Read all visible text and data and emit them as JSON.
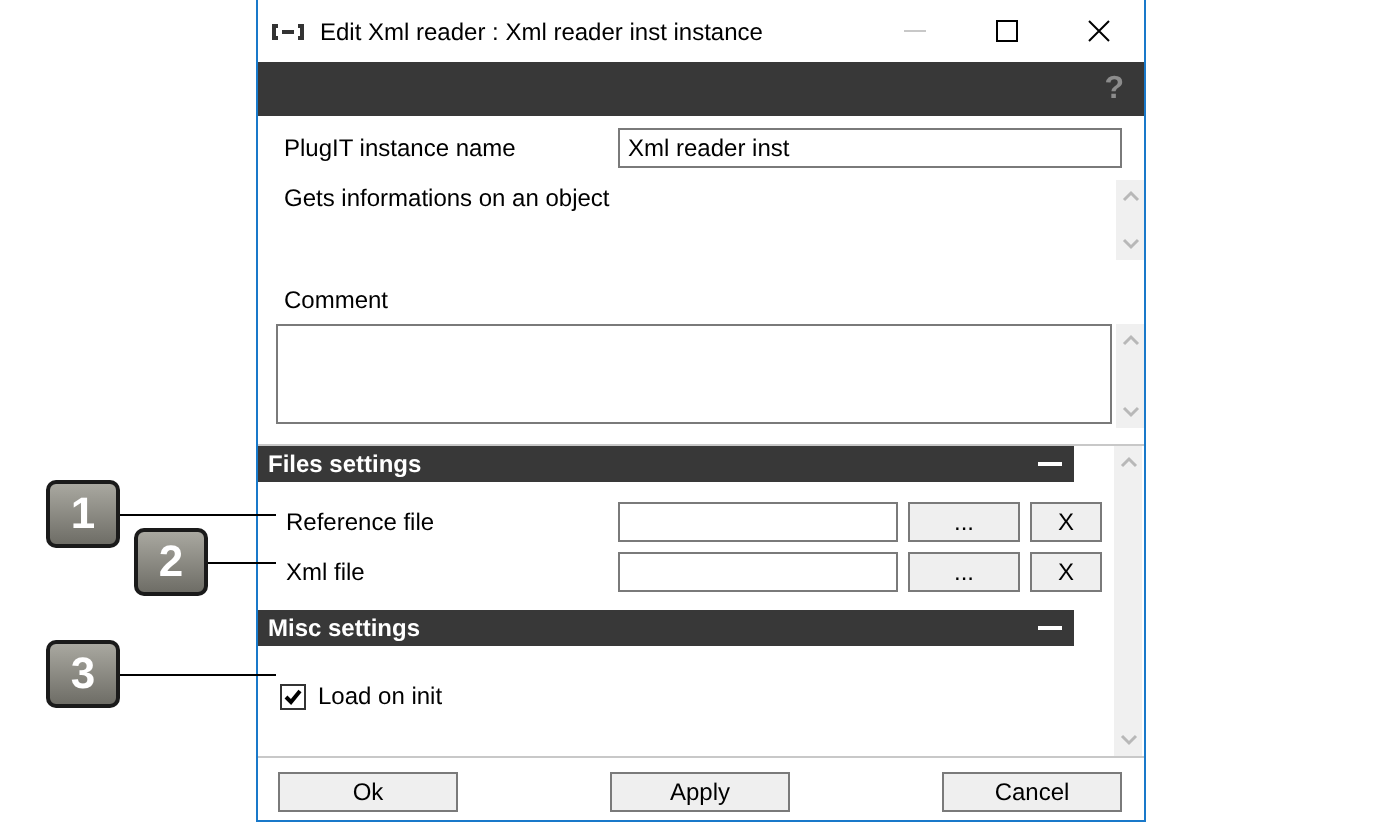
{
  "window": {
    "title": "Edit Xml reader : Xml reader inst instance",
    "help": "?"
  },
  "general": {
    "instance_name_label": "PlugIT instance name",
    "instance_name": "Xml reader inst",
    "description": "Gets informations on an object",
    "comment_label": "Comment"
  },
  "sections": [
    {
      "title": "Files settings",
      "expanded": true,
      "rows": [
        {
          "kind": "file",
          "label": "Reference file",
          "browse": "...",
          "clear": "X"
        },
        {
          "kind": "file",
          "label": "Xml file",
          "browse": "...",
          "clear": "X"
        }
      ]
    },
    {
      "title": "Misc settings",
      "expanded": true,
      "rows": [
        {
          "kind": "checkbox",
          "label": "Load on init",
          "checked": true
        }
      ]
    }
  ],
  "buttons": [
    "Ok",
    "Apply",
    "Cancel"
  ],
  "callouts": [
    {
      "number": "1"
    },
    {
      "number": "2"
    },
    {
      "number": "3"
    }
  ]
}
